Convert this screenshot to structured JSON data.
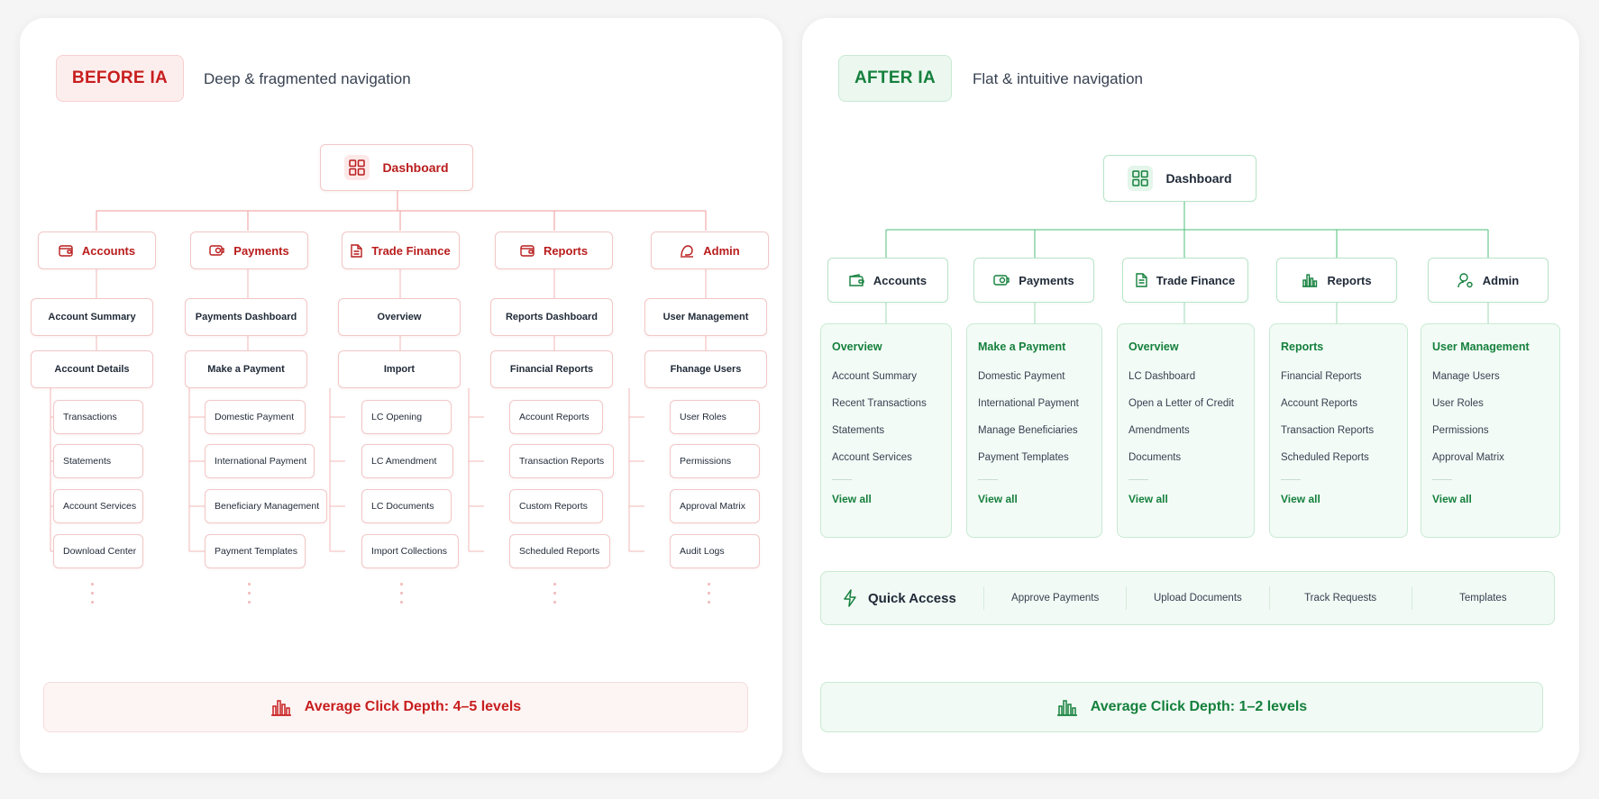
{
  "before": {
    "badge": "BEFORE IA",
    "subtitle": "Deep & fragmented navigation",
    "root": "Dashboard",
    "columns": [
      {
        "cat": "Accounts",
        "icon": "wallet-icon",
        "l1": "Account Summary",
        "l2": "Account Details",
        "leaves": [
          "Transactions",
          "Statements",
          "Account Services",
          "Download Center"
        ]
      },
      {
        "cat": "Payments",
        "icon": "payment-icon",
        "l1": "Payments Dashboard",
        "l2": "Make a Payment",
        "leaves": [
          "Domestic Payment",
          "International Payment",
          "Beneficiary Management",
          "Payment Templates"
        ]
      },
      {
        "cat": "Trade Finance",
        "icon": "document-icon",
        "l1": "Overview",
        "l2": "Import",
        "leaves": [
          "LC Opening",
          "LC Amendment",
          "LC Documents",
          "Import Collections"
        ]
      },
      {
        "cat": "Reports",
        "icon": "folder-icon",
        "l1": "Reports Dashboard",
        "l2": "Financial Reports",
        "leaves": [
          "Account Reports",
          "Transaction Reports",
          "Custom Reports",
          "Scheduled Reports"
        ]
      },
      {
        "cat": "Admin",
        "icon": "admin-icon",
        "l1": "User Management",
        "l2": "Fhanage Users",
        "leaves": [
          "User Roles",
          "Permissions",
          "Approval Matrix",
          "Audit Logs"
        ]
      }
    ],
    "footer": "Average Click Depth: 4–5 levels",
    "accent": "#c81e1e"
  },
  "after": {
    "badge": "AFTER IA",
    "subtitle": "Flat & intuitive navigation",
    "root": "Dashboard",
    "columns": [
      {
        "cat": "Accounts",
        "icon": "wallet-icon",
        "head": "Overview",
        "items": [
          "Account Summary",
          "Recent Transactions",
          "Statements",
          "Account Services"
        ],
        "view_all": "View all"
      },
      {
        "cat": "Payments",
        "icon": "payment-icon",
        "head": "Make a Payment",
        "items": [
          "Domestic Payment",
          "International Payment",
          "Manage Beneficiaries",
          "Payment Templates"
        ],
        "view_all": "View all"
      },
      {
        "cat": "Trade Finance",
        "icon": "document-icon",
        "head": "Overview",
        "items": [
          "LC Dashboard",
          "Open a Letter of Credit",
          "Amendments",
          "Documents"
        ],
        "view_all": "View all"
      },
      {
        "cat": "Reports",
        "icon": "bar-chart-icon",
        "head": "Reports",
        "items": [
          "Financial Reports",
          "Account Reports",
          "Transaction Reports",
          "Scheduled Reports"
        ],
        "view_all": "View all"
      },
      {
        "cat": "Admin",
        "icon": "user-icon",
        "head": "User Management",
        "items": [
          "Manage Users",
          "User Roles",
          "Permissions",
          "Approval Matrix"
        ],
        "view_all": "View all"
      }
    ],
    "quick_access": {
      "title": "Quick Access",
      "items": [
        "Approve Payments",
        "Upload Documents",
        "Track Requests",
        "Templates"
      ]
    },
    "footer": "Average Click Depth: 1–2 levels",
    "accent": "#15803d"
  }
}
